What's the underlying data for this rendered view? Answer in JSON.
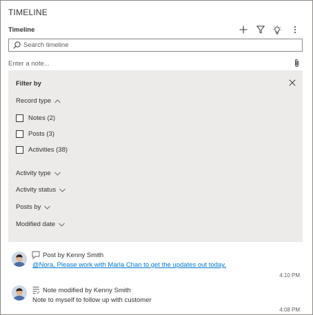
{
  "header": {
    "title": "TIMELINE",
    "subtitle": "Timeline",
    "tools": [
      "add-icon",
      "filter-icon",
      "lightbulb-icon",
      "more-icon"
    ]
  },
  "search": {
    "placeholder": "Search timeline",
    "value": ""
  },
  "note": {
    "placeholder": "Enter a note...",
    "value": ""
  },
  "filter": {
    "title": "Filter by",
    "record_type": {
      "label": "Record type",
      "expanded": true,
      "options": [
        {
          "label": "Notes (2)",
          "checked": false
        },
        {
          "label": "Posts (3)",
          "checked": false
        },
        {
          "label": "Activities (38)",
          "checked": false
        }
      ]
    },
    "groups": [
      {
        "label": "Activity type"
      },
      {
        "label": "Activity status"
      },
      {
        "label": "Posts by"
      },
      {
        "label": "Modified date"
      }
    ]
  },
  "entries": [
    {
      "type_icon": "post-icon",
      "title": "Post by Kenny Smith",
      "body": "@Nora, Please work with Marla Chan to get the updates out today.",
      "body_is_link": true,
      "time": "4:10 PM"
    },
    {
      "type_icon": "note-icon",
      "title": "Note modified by Kenny Smith",
      "body": "Note to myself to follow up with customer",
      "body_is_link": false,
      "time": "4:08 PM"
    }
  ],
  "colors": {
    "border": "#8a8886",
    "panel_bg": "#edebe9",
    "link": "#0078d4",
    "text": "#323130"
  }
}
